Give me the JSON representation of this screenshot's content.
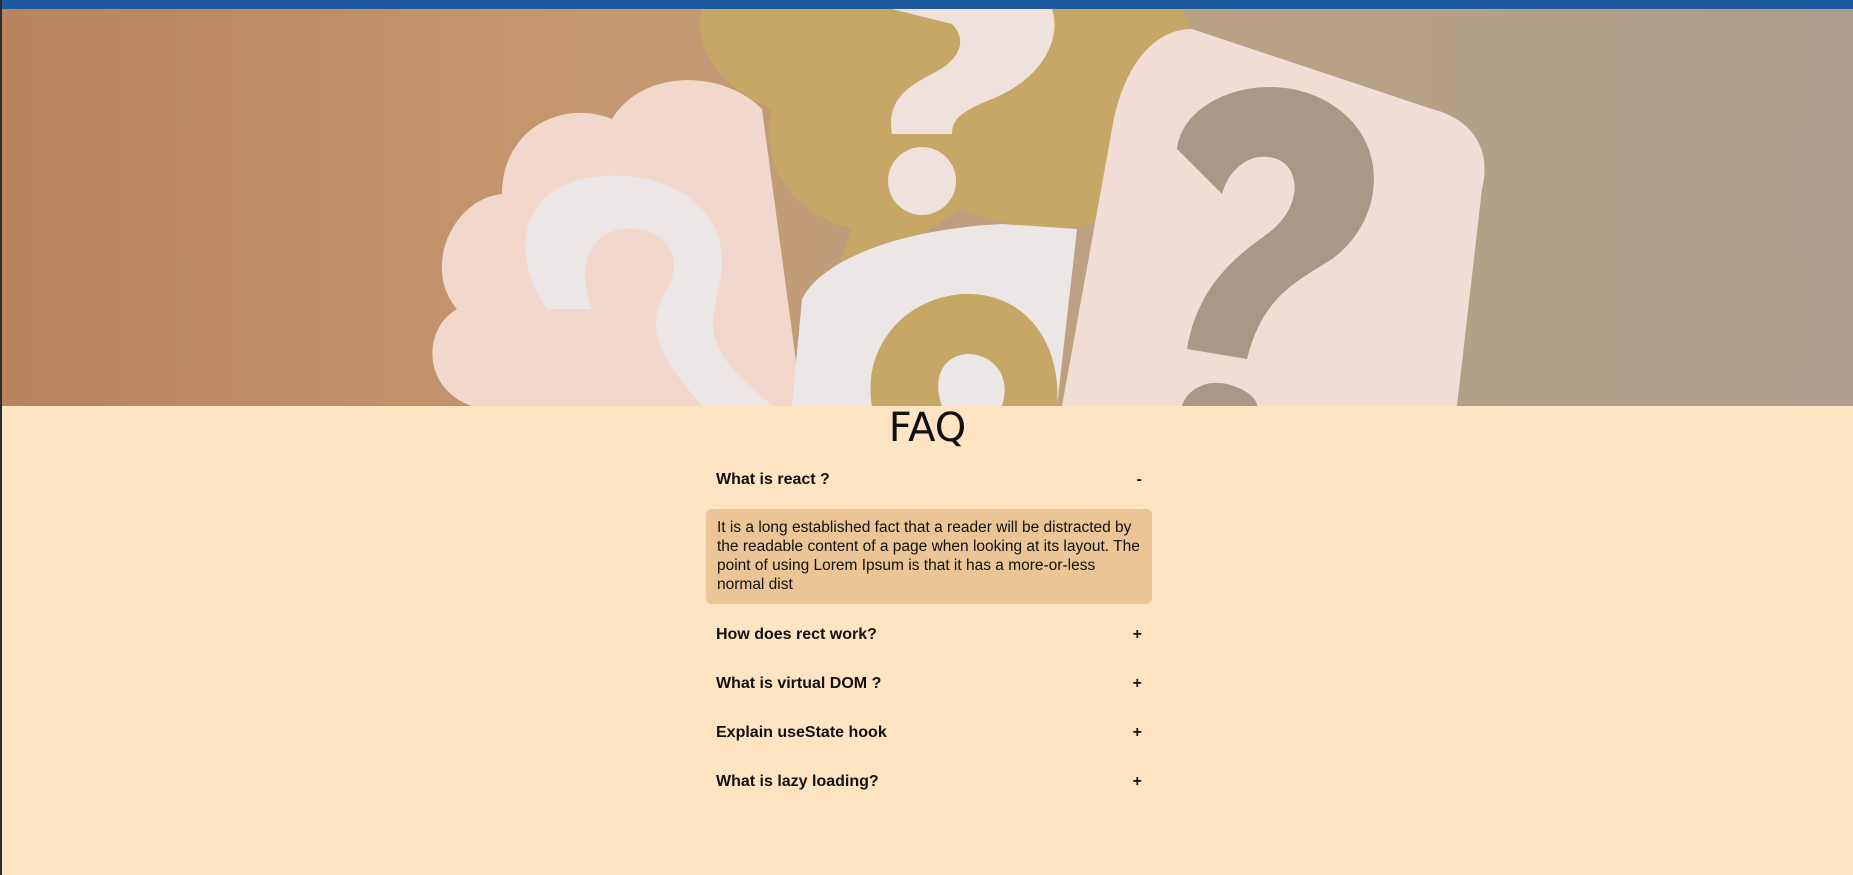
{
  "page": {
    "title": "FAQ"
  },
  "hero": {
    "image": "question-marks-paper-cutouts"
  },
  "faqs": [
    {
      "question": "What is react ?",
      "toggle": "-",
      "expanded": true,
      "answer": "It is a long established fact that a reader will be distracted by the readable content of a page when looking at its layout. The point of using Lorem Ipsum is that it has a more-or-less normal dist"
    },
    {
      "question": "How does rect work?",
      "toggle": "+",
      "expanded": false
    },
    {
      "question": "What is virtual DOM ?",
      "toggle": "+",
      "expanded": false
    },
    {
      "question": "Explain useState hook",
      "toggle": "+",
      "expanded": false
    },
    {
      "question": "What is lazy loading?",
      "toggle": "+",
      "expanded": false
    }
  ],
  "colors": {
    "background": "#ffe4c4",
    "answer_background": "#ebc596",
    "top_bar": "#1e5aa0"
  }
}
